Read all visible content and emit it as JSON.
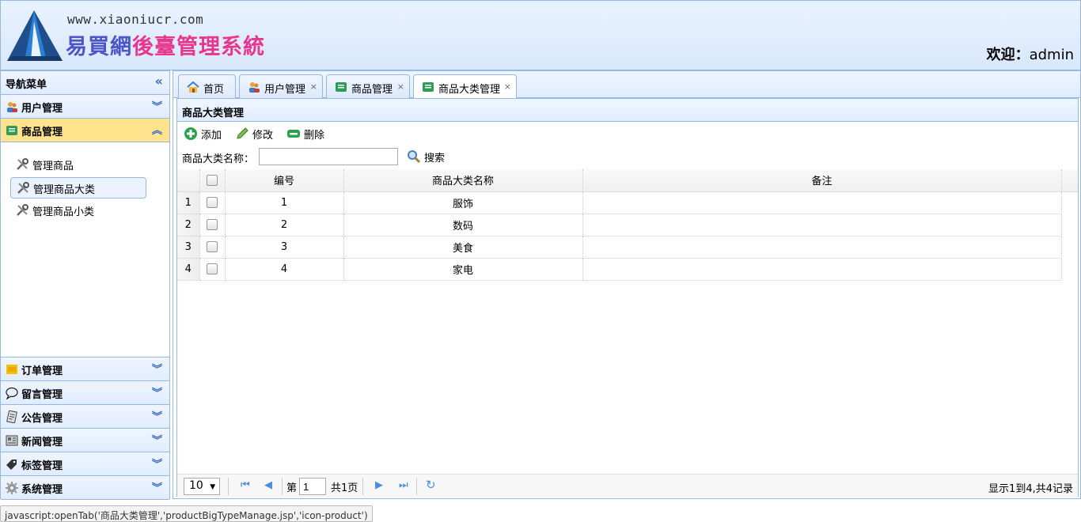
{
  "header": {
    "url": "www.xiaoniucr.com",
    "title_part1": "易買網",
    "title_part2": "後臺管理系統",
    "welcome_label": "欢迎：",
    "username": "admin"
  },
  "nav": {
    "title": "导航菜单",
    "groups": [
      {
        "label": "用户管理",
        "icon": "users-icon"
      },
      {
        "label": "商品管理",
        "icon": "product-icon",
        "items": [
          {
            "label": "管理商品"
          },
          {
            "label": "管理商品大类"
          },
          {
            "label": "管理商品小类"
          }
        ]
      },
      {
        "label": "订单管理",
        "icon": "order-icon"
      },
      {
        "label": "留言管理",
        "icon": "message-icon"
      },
      {
        "label": "公告管理",
        "icon": "notice-icon"
      },
      {
        "label": "新闻管理",
        "icon": "news-icon"
      },
      {
        "label": "标签管理",
        "icon": "tag-icon"
      },
      {
        "label": "系统管理",
        "icon": "gear-icon"
      }
    ]
  },
  "tabs": [
    {
      "label": "首页",
      "icon": "home-icon"
    },
    {
      "label": "用户管理",
      "icon": "users-icon",
      "close": "×"
    },
    {
      "label": "商品管理",
      "icon": "product-icon",
      "close": "×"
    },
    {
      "label": "商品大类管理",
      "icon": "product-icon",
      "close": "×"
    }
  ],
  "panel": {
    "title": "商品大类管理",
    "toolbar": {
      "add": "添加",
      "edit": "修改",
      "delete": "删除"
    },
    "search": {
      "label": "商品大类名称：",
      "value": "",
      "button": "搜索"
    },
    "columns": [
      "编号",
      "商品大类名称",
      "备注"
    ],
    "rows": [
      {
        "rownum": "1",
        "id": "1",
        "name": "服饰",
        "remark": ""
      },
      {
        "rownum": "2",
        "id": "2",
        "name": "数码",
        "remark": ""
      },
      {
        "rownum": "3",
        "id": "3",
        "name": "美食",
        "remark": ""
      },
      {
        "rownum": "4",
        "id": "4",
        "name": "家电",
        "remark": ""
      }
    ],
    "pager": {
      "page_size": "10",
      "page_prefix": "第",
      "page": "1",
      "page_total": "共1页",
      "info": "显示1到4,共4记录"
    }
  },
  "statusbar": "javascript:openTab('商品大类管理','productBigTypeManage.jsp','icon-product')",
  "colors": {
    "border": "#95b8e7",
    "selected": "#ffe48d",
    "accent": "#3a6cc5"
  }
}
